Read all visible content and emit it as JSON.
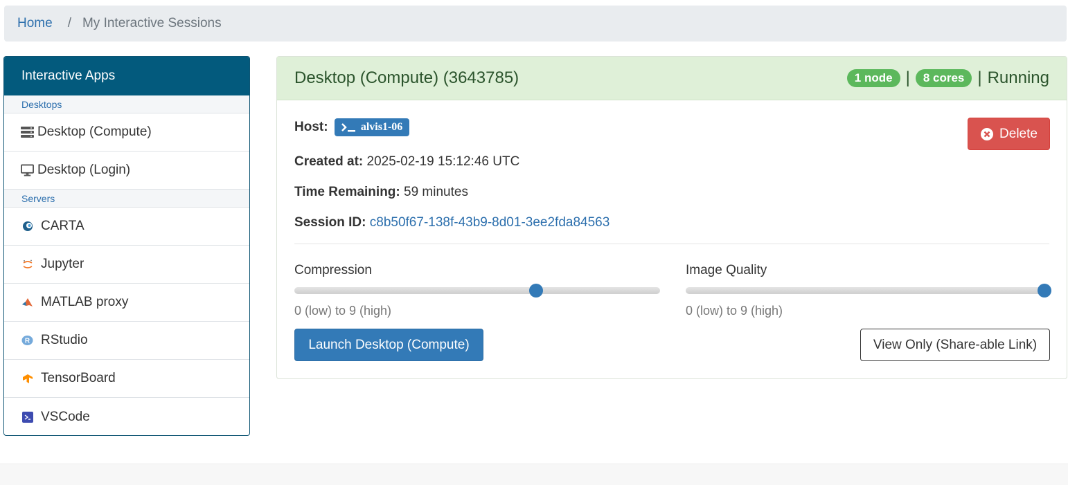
{
  "breadcrumb": {
    "home": "Home",
    "separator": "/",
    "current": "My Interactive Sessions"
  },
  "sidebar": {
    "title": "Interactive Apps",
    "categories": [
      {
        "label": "Desktops",
        "items": [
          {
            "label": "Desktop (Compute)",
            "icon": "server-icon"
          },
          {
            "label": "Desktop (Login)",
            "icon": "monitor-icon"
          }
        ]
      },
      {
        "label": "Servers",
        "items": [
          {
            "label": "CARTA",
            "icon": "carta-icon"
          },
          {
            "label": "Jupyter",
            "icon": "jupyter-icon"
          },
          {
            "label": "MATLAB proxy",
            "icon": "matlab-icon"
          },
          {
            "label": "RStudio",
            "icon": "rstudio-icon"
          },
          {
            "label": "TensorBoard",
            "icon": "tensorboard-icon"
          },
          {
            "label": "VSCode",
            "icon": "vscode-icon"
          }
        ]
      }
    ]
  },
  "session": {
    "title": "Desktop (Compute) (3643785)",
    "nodes": "1 node",
    "cores": "8 cores",
    "separator": "|",
    "status": "Running",
    "host_label": "Host:",
    "host": "alvis1-06",
    "created_label": "Created at:",
    "created": "2025-02-19 15:12:46 UTC",
    "remaining_label": "Time Remaining:",
    "remaining": "59 minutes",
    "session_id_label": "Session ID:",
    "session_id": "c8b50f67-138f-43b9-8d01-3ee2fda84563",
    "delete_label": "Delete",
    "compression": {
      "label": "Compression",
      "help": "0 (low) to 9 (high)",
      "value": 6,
      "min": 0,
      "max": 9
    },
    "image_quality": {
      "label": "Image Quality",
      "help": "0 (low) to 9 (high)",
      "value": 9,
      "min": 0,
      "max": 9
    },
    "launch_label": "Launch Desktop (Compute)",
    "share_label": "View Only (Share-able Link)"
  },
  "colors": {
    "primary": "#337ab7",
    "success": "#5cb85c",
    "danger": "#d9534f",
    "sidebar_head": "#035a7d"
  }
}
